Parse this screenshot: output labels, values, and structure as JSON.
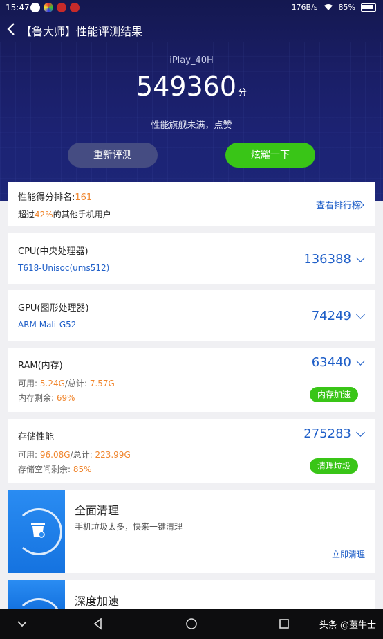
{
  "status_bar": {
    "time": "15:47",
    "net_speed": "176B/s",
    "battery": "85%"
  },
  "header": {
    "title": "【鲁大师】性能评测结果"
  },
  "hero": {
    "device": "iPlay_40H",
    "score": "549360",
    "score_unit": "分",
    "slogan": "性能旗舰未满，点赞",
    "retest_button": "重新评测",
    "share_button": "炫耀一下"
  },
  "ranking": {
    "label": "性能得分排名:",
    "rank": "161",
    "beat_prefix": "超过",
    "beat_percent": "42%",
    "beat_suffix": "的其他手机用户",
    "link": "查看排行榜"
  },
  "cpu": {
    "label": "CPU(中央处理器)",
    "model": "T618-Unisoc(ums512)",
    "score": "136388"
  },
  "gpu": {
    "label": "GPU(图形处理器)",
    "model": "ARM Mali-G52",
    "score": "74249"
  },
  "ram": {
    "label": "RAM(内存)",
    "score": "63440",
    "avail_label": "可用:",
    "avail": "5.24G",
    "total_label": "/总计:",
    "total": "7.57G",
    "free_label": "内存剩余:",
    "free": "69%",
    "button": "内存加速"
  },
  "storage": {
    "label": "存储性能",
    "score": "275283",
    "avail_label": "可用:",
    "avail": "96.08G",
    "total_label": "/总计:",
    "total": "223.99G",
    "free_label": "存储空间剩余:",
    "free": "85%",
    "button": "清理垃圾"
  },
  "promo_clean": {
    "title": "全面清理",
    "desc": "手机垃圾太多，快来一键清理",
    "link": "立即清理"
  },
  "promo_boost": {
    "title": "深度加速"
  },
  "nav": {
    "watermark": "头条 @薑牛士"
  },
  "colors": {
    "accent_green": "#39c517",
    "accent_blue": "#1f5fc8",
    "accent_orange": "#f0862e",
    "hero_bg": "#1a1e66"
  }
}
